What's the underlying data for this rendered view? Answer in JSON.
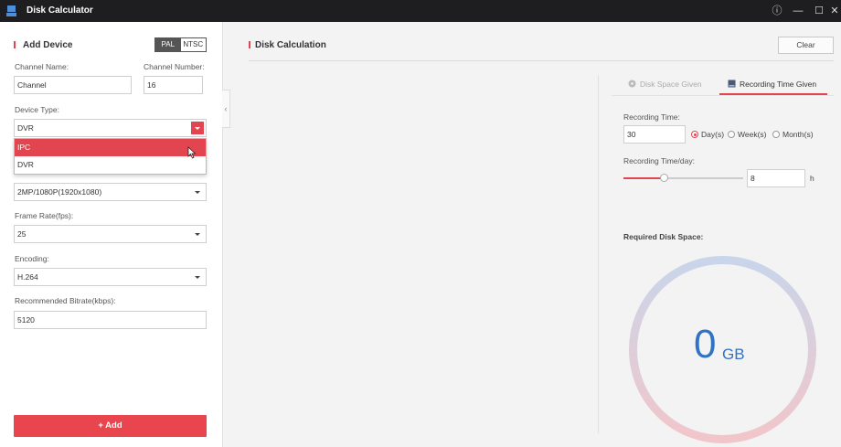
{
  "window": {
    "title": "Disk Calculator",
    "controls": {
      "info": "ⓘ",
      "minimize": "—",
      "maximize": "☐",
      "close": "✕"
    }
  },
  "left_panel": {
    "title": "Add Device",
    "standard_toggle": {
      "options": [
        "PAL",
        "NTSC"
      ],
      "selected": "PAL"
    },
    "channel_name": {
      "label": "Channel Name:",
      "value": "Channel"
    },
    "channel_number": {
      "label": "Channel Number:",
      "value": "16"
    },
    "device_type": {
      "label": "Device Type:",
      "value": "DVR",
      "options": [
        "IPC",
        "DVR"
      ],
      "highlighted": "IPC"
    },
    "resolution": {
      "value": "2MP/1080P(1920x1080)"
    },
    "frame_rate": {
      "label": "Frame Rate(fps):",
      "value": "25"
    },
    "encoding": {
      "label": "Encoding:",
      "value": "H.264"
    },
    "bitrate": {
      "label": "Recommended Bitrate(kbps):",
      "value": "5120"
    },
    "add_button": "+ Add"
  },
  "main": {
    "title": "Disk Calculation",
    "clear_button": "Clear",
    "tabs": [
      {
        "label": "Disk Space Given",
        "active": false
      },
      {
        "label": "Recording Time Given",
        "active": true
      }
    ],
    "recording_time": {
      "label": "Recording Time:",
      "value": "30",
      "units": [
        "Day(s)",
        "Week(s)",
        "Month(s)"
      ],
      "selected_unit": "Day(s)"
    },
    "recording_time_per_day": {
      "label": "Recording Time/day:",
      "value": "8",
      "unit": "h",
      "slider_fraction": 0.333
    },
    "required_disk_space": {
      "label": "Required Disk Space:",
      "value": "0",
      "unit": "GB"
    }
  },
  "colors": {
    "accent": "#e2454f",
    "value_blue": "#2f73c4",
    "titlebar": "#1e1e21"
  }
}
